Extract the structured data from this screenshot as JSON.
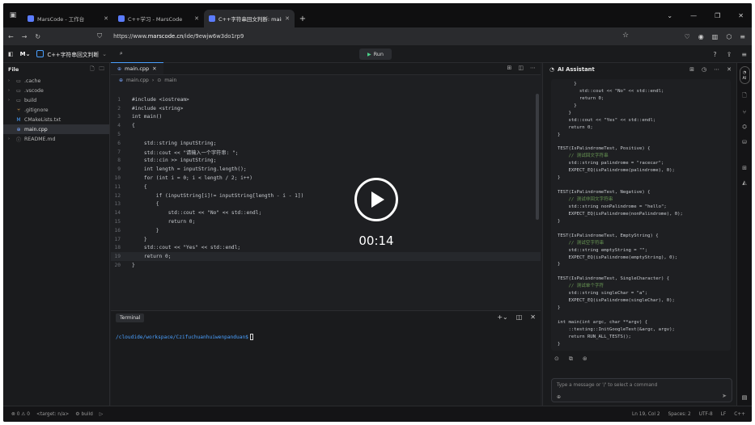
{
  "browser": {
    "tabs": [
      {
        "title": "MarsCode - 工作台",
        "active": false
      },
      {
        "title": "C++学习 - MarsCode",
        "active": false
      },
      {
        "title": "C++字符串回文判断: main.cpp",
        "active": true
      }
    ],
    "new_tab": "+",
    "url_prefix": "https://www.",
    "url_domain": "marscode.cn",
    "url_path": "/ide/9ewjw6w3do1rp9"
  },
  "ide": {
    "project_name": "C++字符串回文判断",
    "run_label": "Run"
  },
  "explorer": {
    "title": "File",
    "items": [
      {
        "name": ".cache",
        "type": "folder"
      },
      {
        "name": ".vscode",
        "type": "folder"
      },
      {
        "name": "build",
        "type": "folder"
      },
      {
        "name": ".gitignore",
        "type": "git"
      },
      {
        "name": "CMakeLists.txt",
        "type": "cmake"
      },
      {
        "name": "main.cpp",
        "type": "cpp",
        "selected": true
      },
      {
        "name": "README.md",
        "type": "md"
      }
    ]
  },
  "editor": {
    "tab": "main.cpp",
    "breadcrumb_file": "main.cpp",
    "breadcrumb_symbol": "main",
    "lines": [
      "#include <iostream>",
      "#include <string>",
      "int main()",
      "{",
      "",
      "    std::string inputString;",
      "    std::cout << \"请输入一个字符串: \";",
      "    std::cin >> inputString;",
      "    int length = inputString.length();",
      "    for (int i = 0; i < length / 2; i++)",
      "    {",
      "        if (inputString[i]!= inputString[length - i - 1])",
      "        {",
      "            std::cout << \"No\" << std::endl;",
      "            return 0;",
      "        }",
      "    }",
      "    std::cout << \"Yes\" << std::endl;",
      "    return 0;",
      "}"
    ],
    "current_line": 19
  },
  "video": {
    "time": "00:14"
  },
  "terminal": {
    "tab": "Terminal",
    "prompt": "/cloudide/workspace/Czifuchuanhuiwenpanduan$"
  },
  "ai": {
    "title": "AI Assistant",
    "code_lines": [
      "      }",
      "        std::cout << \"No\" << std::endl;",
      "        return 0;",
      "      }",
      "    }",
      "    std::cout << \"Yes\" << std::endl;",
      "    return 0;",
      "}",
      "",
      "TEST(IsPalindromeTest, Positive) {",
      "    // 测试回文字符串",
      "    std::string palindrome = \"racecar\";",
      "    EXPECT_EQ(isPalindrome(palindrome), 0);",
      "}",
      "",
      "TEST(IsPalindromeTest, Negative) {",
      "    // 测试非回文字符串",
      "    std::string nonPalindrome = \"hello\";",
      "    EXPECT_EQ(isPalindrome(nonPalindrome), 0);",
      "}",
      "",
      "TEST(IsPalindromeTest, EmptyString) {",
      "    // 测试空字符串",
      "    std::string emptyString = \"\";",
      "    EXPECT_EQ(isPalindrome(emptyString), 0);",
      "}",
      "",
      "TEST(IsPalindromeTest, SingleCharacter) {",
      "    // 测试单个字符",
      "    std::string singleChar = \"a\";",
      "    EXPECT_EQ(isPalindrome(singleChar), 0);",
      "}",
      "",
      "int main(int argc, char **argv) {",
      "    ::testing::InitGoogleTest(&argc, argv);",
      "    return RUN_ALL_TESTS();",
      "}"
    ],
    "input_placeholder": "Type a message or '/' to select a command"
  },
  "rail": {
    "ai_label": "AI"
  },
  "status": {
    "left": "⊗ 0  ⚠ 0",
    "branch": "<target: n/a>",
    "build": "build",
    "position": "Ln 19, Col 2",
    "spaces": "Spaces: 2",
    "encoding": "UTF-8",
    "eol": "LF",
    "lang": "C++"
  },
  "colors": {
    "accent": "#4aa0ff",
    "run": "#4bd38a",
    "bg": "#1e1f22"
  }
}
